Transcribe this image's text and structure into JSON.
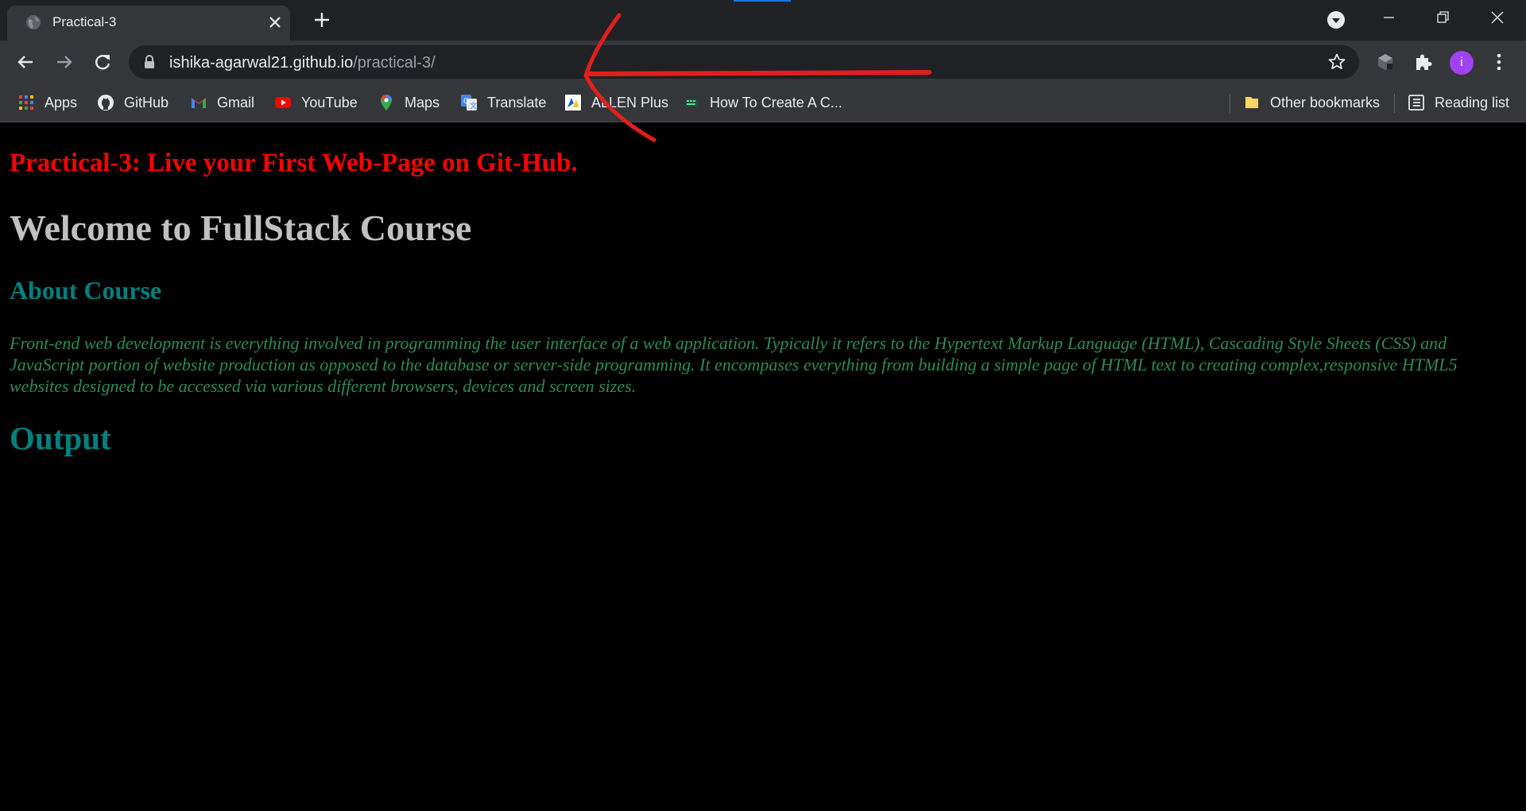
{
  "browser": {
    "tab": {
      "title": "Practical-3"
    },
    "address_bar": {
      "host": "ishika-agarwal21.github.io",
      "path": "/practical-3/"
    },
    "profile_initial": "i",
    "bookmarks": [
      {
        "label": "Apps",
        "icon": "apps-grid-icon"
      },
      {
        "label": "GitHub",
        "icon": "github-icon"
      },
      {
        "label": "Gmail",
        "icon": "gmail-icon"
      },
      {
        "label": "YouTube",
        "icon": "youtube-icon"
      },
      {
        "label": "Maps",
        "icon": "maps-icon"
      },
      {
        "label": "Translate",
        "icon": "translate-icon"
      },
      {
        "label": "ALLEN Plus",
        "icon": "allen-icon"
      },
      {
        "label": "How To Create A C...",
        "icon": "site-favicon-icon"
      }
    ],
    "other_bookmarks": "Other bookmarks",
    "reading_list": "Reading list"
  },
  "page": {
    "practical_heading": "Practical-3: Live your First Web-Page on Git-Hub.",
    "welcome_heading": "Welcome to FullStack Course",
    "about_heading": "About Course",
    "about_text": "Front-end web development is everything involved in programming the user interface of a web application. Typically it refers to the Hypertext Markup Language (HTML), Cascading Style Sheets (CSS) and JavaScript portion of website production as opposed to the database or server-side programming. It encompases everything from building a simple page of HTML text to creating complex,responsive HTML5 websites designed to be accessed via various different browsers, devices and screen sizes.",
    "output_heading": "Output"
  },
  "colors": {
    "practical_heading": "#ff0000",
    "welcome_heading": "#c0c0c0",
    "teal_headings": "#008080",
    "paragraph": "#2e8b57",
    "annotation_arrow": "#e0201b"
  }
}
